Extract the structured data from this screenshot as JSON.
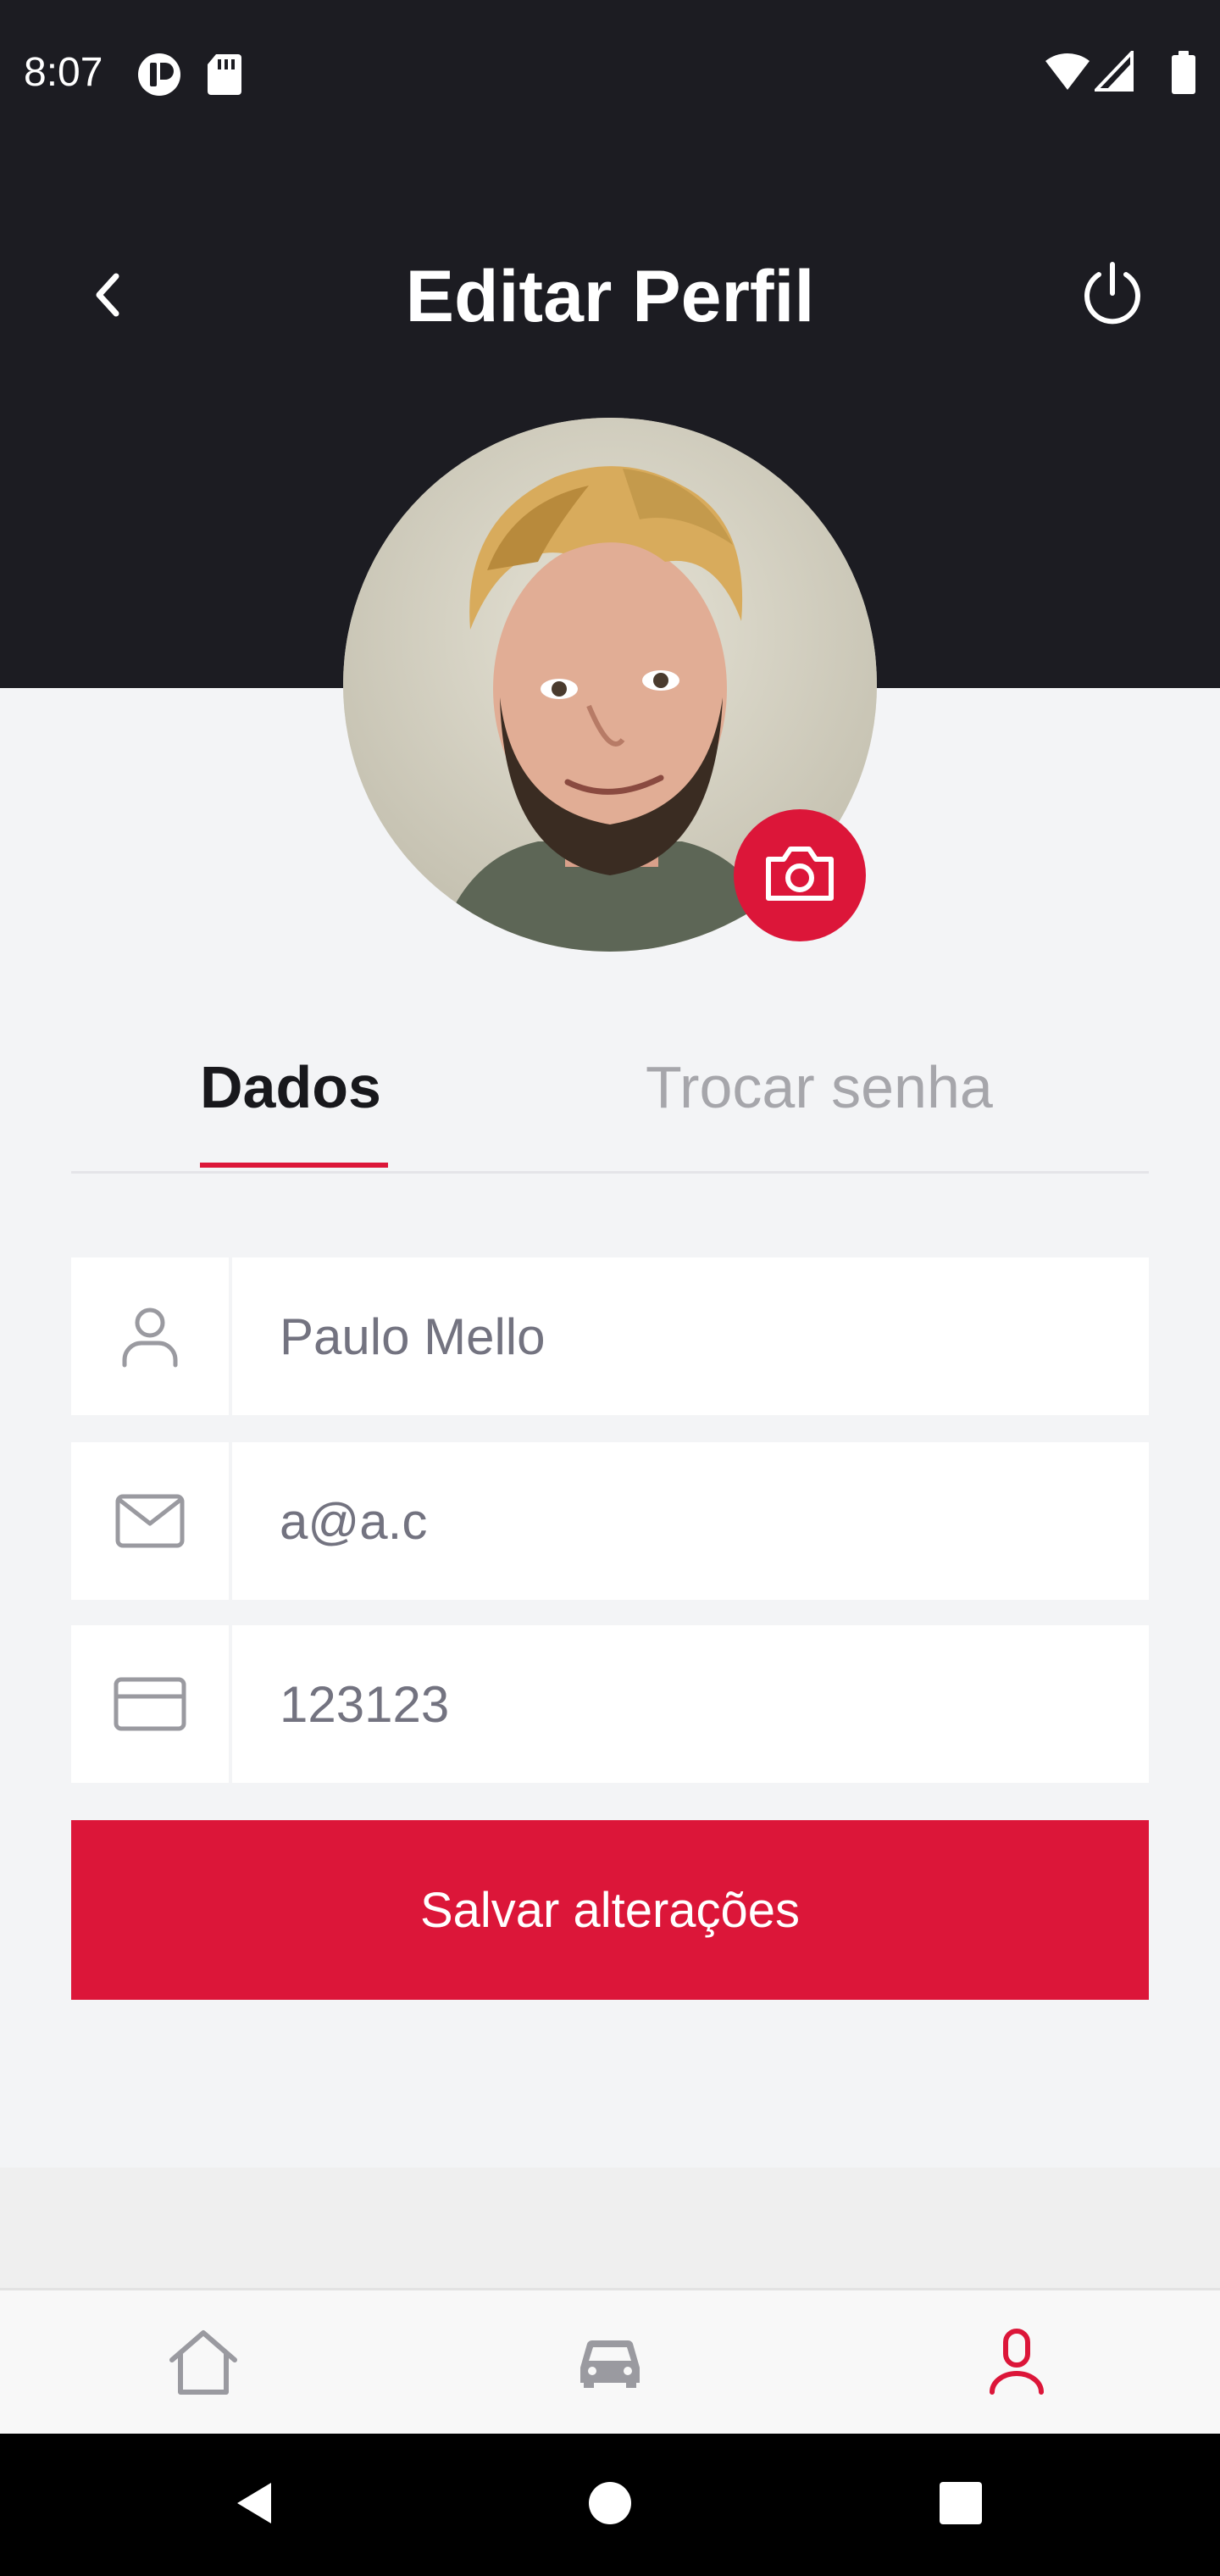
{
  "status_bar": {
    "time": "8:07",
    "icons": [
      "notification-app-icon",
      "sd-card-icon",
      "wifi-icon",
      "signal-icon",
      "battery-icon"
    ]
  },
  "header": {
    "title": "Editar Perfil",
    "back_icon": "chevron-left-icon",
    "logout_icon": "power-icon",
    "background": "#1c1c22"
  },
  "profile": {
    "avatar": "profile-photo",
    "camera_icon": "camera-icon"
  },
  "tabs": [
    {
      "label": "Dados",
      "active": true
    },
    {
      "label": "Trocar senha",
      "active": false
    }
  ],
  "form": {
    "fields": [
      {
        "icon": "user-icon",
        "value": "Paulo Mello"
      },
      {
        "icon": "mail-icon",
        "value": "a@a.c"
      },
      {
        "icon": "credit-card-icon",
        "value": "123123"
      }
    ],
    "save_label": "Salvar alterações"
  },
  "bottom_nav": [
    {
      "icon": "home-icon",
      "active": false
    },
    {
      "icon": "car-icon",
      "active": false
    },
    {
      "icon": "profile-icon",
      "active": true
    }
  ],
  "system_nav": [
    "back-triangle-icon",
    "home-circle-icon",
    "recents-square-icon"
  ],
  "colors": {
    "accent": "#dc1639",
    "header_bg": "#1c1c22",
    "page_bg": "#f3f4f6",
    "inactive_tab": "#a6a6ab",
    "icon_gray": "#9a9aa0"
  }
}
